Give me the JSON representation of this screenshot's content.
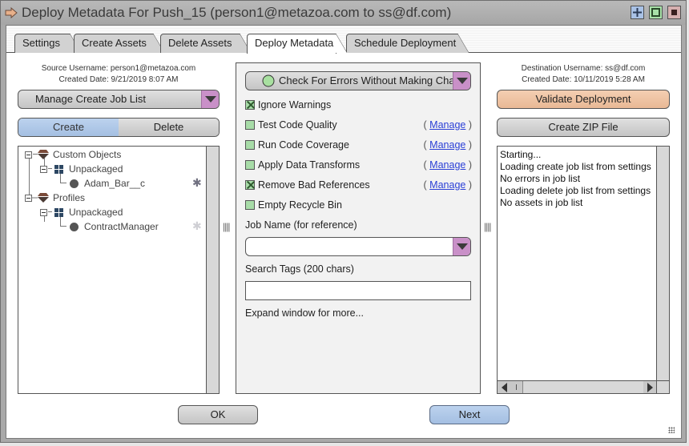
{
  "window": {
    "title": "Deploy Metadata For Push_15 (person1@metazoa.com to ss@df.com)",
    "buttons": [
      "maximize",
      "restore",
      "close"
    ]
  },
  "tabs": [
    {
      "label": "Settings",
      "active": false
    },
    {
      "label": "Create Assets",
      "active": false
    },
    {
      "label": "Delete Assets",
      "active": false
    },
    {
      "label": "Deploy Metadata",
      "active": true
    },
    {
      "label": "Schedule Deployment",
      "active": false
    }
  ],
  "source": {
    "username_line": "Source Username: person1@metazoa.com",
    "date_line": "Created Date: 9/21/2019 8:07 AM",
    "job_list_dropdown": "Manage Create Job List",
    "segment": {
      "create": "Create",
      "delete": "Delete",
      "selected": "Create"
    },
    "tree": [
      {
        "label": "Custom Objects",
        "level": 0,
        "icon": "diamond-icon"
      },
      {
        "label": "Unpackaged",
        "level": 1,
        "icon": "package-grid-icon"
      },
      {
        "label": "Adam_Bar__c",
        "level": 2,
        "icon": "circle-icon",
        "marker": "asterisk-dark"
      },
      {
        "label": "Profiles",
        "level": 0,
        "icon": "diamond-icon"
      },
      {
        "label": "Unpackaged",
        "level": 1,
        "icon": "package-grid-icon"
      },
      {
        "label": "ContractManager",
        "level": 2,
        "icon": "circle-icon",
        "marker": "asterisk-light"
      }
    ]
  },
  "deploy": {
    "mode_dropdown": "Check For Errors Without Making Changes",
    "options": [
      {
        "label": "Ignore Warnings",
        "checked": true,
        "manage": null
      },
      {
        "label": "Test Code Quality",
        "checked": false,
        "manage": "Manage"
      },
      {
        "label": "Run Code Coverage",
        "checked": false,
        "manage": "Manage"
      },
      {
        "label": "Apply Data Transforms",
        "checked": false,
        "manage": "Manage"
      },
      {
        "label": "Remove Bad References",
        "checked": true,
        "manage": "Manage"
      },
      {
        "label": "Empty Recycle Bin",
        "checked": false,
        "manage": null
      }
    ],
    "job_name_label": "Job Name (for reference)",
    "job_name_value": "",
    "search_tags_label": "Search Tags (200 chars)",
    "search_tags_value": "",
    "expand_hint": "Expand window for more..."
  },
  "destination": {
    "username_line": "Destination Username: ss@df.com",
    "date_line": "Created Date: 10/11/2019 5:28 AM",
    "validate_button": "Validate Deployment",
    "zip_button": "Create ZIP File",
    "log": [
      "Starting...",
      "Loading create job list from settings",
      "No errors in job list",
      "Loading delete job list from settings",
      "No assets in job list"
    ]
  },
  "footer": {
    "ok": "OK",
    "next": "Next"
  },
  "splitter_glyph": "||||"
}
